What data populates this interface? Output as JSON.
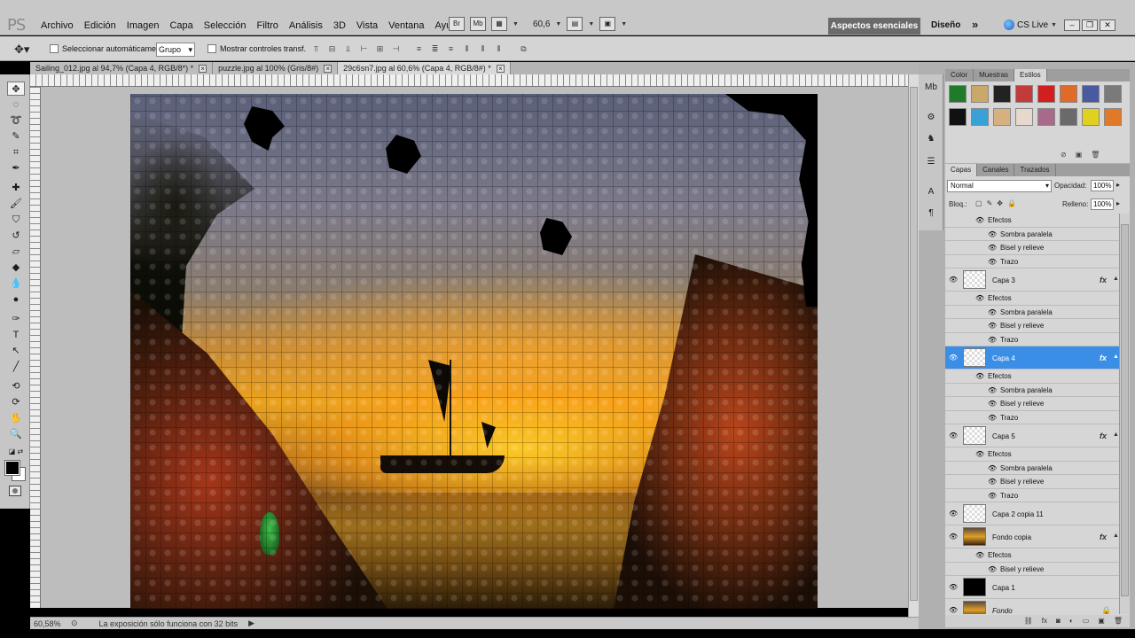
{
  "app": {
    "logo": "PS",
    "menu": [
      "Archivo",
      "Edición",
      "Imagen",
      "Capa",
      "Selección",
      "Filtro",
      "Análisis",
      "3D",
      "Vista",
      "Ventana",
      "Ayuda"
    ],
    "zoom": "60,6",
    "workspace_active": "Aspectos esenciales",
    "workspace_other": "Diseño",
    "more": "»",
    "cs_live": "CS Live"
  },
  "options": {
    "auto_select_label": "Seleccionar automáticamente:",
    "auto_select_value": "Grupo",
    "show_transform_label": "Mostrar controles transf."
  },
  "tabs": [
    {
      "label": "Sailing_012.jpg al 94,7% (Capa 4, RGB/8*) *",
      "active": false
    },
    {
      "label": "puzzle.jpg al 100% (Gris/8#)",
      "active": false
    },
    {
      "label": "29c6sn7.jpg al 60,6% (Capa 4, RGB/8#) *",
      "active": true
    }
  ],
  "status": {
    "zoom": "60,58%",
    "message": "La exposición sólo funciona con 32 bits"
  },
  "styles_panel": {
    "tabs": [
      "Color",
      "Muestras",
      "Estilos"
    ],
    "active_tab": "Estilos",
    "swatches": [
      "#1f7a2a",
      "#c9a86a",
      "#222222",
      "#c23a3a",
      "#d21e1e",
      "#e06a28",
      "#4a5aa0",
      "#7a7a7a",
      "#111111",
      "#3aa0d8",
      "#d8b080",
      "#e6d8cc",
      "#a86a8a",
      "#6a6a6a",
      "#e0d020",
      "#e07a28"
    ]
  },
  "layers_panel": {
    "tabs": [
      "Capas",
      "Canales",
      "Trazados"
    ],
    "active_tab": "Capas",
    "blend_mode": "Normal",
    "opacity_label": "Opacidad:",
    "opacity_value": "100%",
    "lock_label": "Bloq.:",
    "fill_label": "Relleno:",
    "fill_value": "100%",
    "rows": [
      {
        "kind": "effects-hdr",
        "text": "Efectos"
      },
      {
        "kind": "effect",
        "text": "Sombra paralela"
      },
      {
        "kind": "effect",
        "text": "Bisel y relieve"
      },
      {
        "kind": "effect",
        "text": "Trazo"
      },
      {
        "kind": "layer",
        "text": "Capa 3",
        "fx": true,
        "thumb": "checker"
      },
      {
        "kind": "effects-hdr",
        "text": "Efectos"
      },
      {
        "kind": "effect",
        "text": "Sombra paralela"
      },
      {
        "kind": "effect",
        "text": "Bisel y relieve"
      },
      {
        "kind": "effect",
        "text": "Trazo"
      },
      {
        "kind": "layer",
        "text": "Capa 4",
        "fx": true,
        "selected": true,
        "thumb": "checker"
      },
      {
        "kind": "effects-hdr",
        "text": "Efectos"
      },
      {
        "kind": "effect",
        "text": "Sombra paralela"
      },
      {
        "kind": "effect",
        "text": "Bisel y relieve"
      },
      {
        "kind": "effect",
        "text": "Trazo"
      },
      {
        "kind": "layer",
        "text": "Capa 5",
        "fx": true,
        "thumb": "checker"
      },
      {
        "kind": "effects-hdr",
        "text": "Efectos"
      },
      {
        "kind": "effect",
        "text": "Sombra paralela"
      },
      {
        "kind": "effect",
        "text": "Bisel y relieve"
      },
      {
        "kind": "effect",
        "text": "Trazo"
      },
      {
        "kind": "layer",
        "text": "Capa 2 copia 11",
        "fx": false,
        "thumb": "checker"
      },
      {
        "kind": "layer",
        "text": "Fondo copia",
        "fx": true,
        "thumb": "sunset"
      },
      {
        "kind": "effects-hdr",
        "text": "Efectos"
      },
      {
        "kind": "effect",
        "text": "Bisel y relieve"
      },
      {
        "kind": "layer",
        "text": "Capa 1",
        "fx": false,
        "thumb": "black"
      },
      {
        "kind": "layer",
        "text": "Fondo",
        "fx": false,
        "thumb": "sunset",
        "locked": true,
        "italic": true
      }
    ]
  }
}
